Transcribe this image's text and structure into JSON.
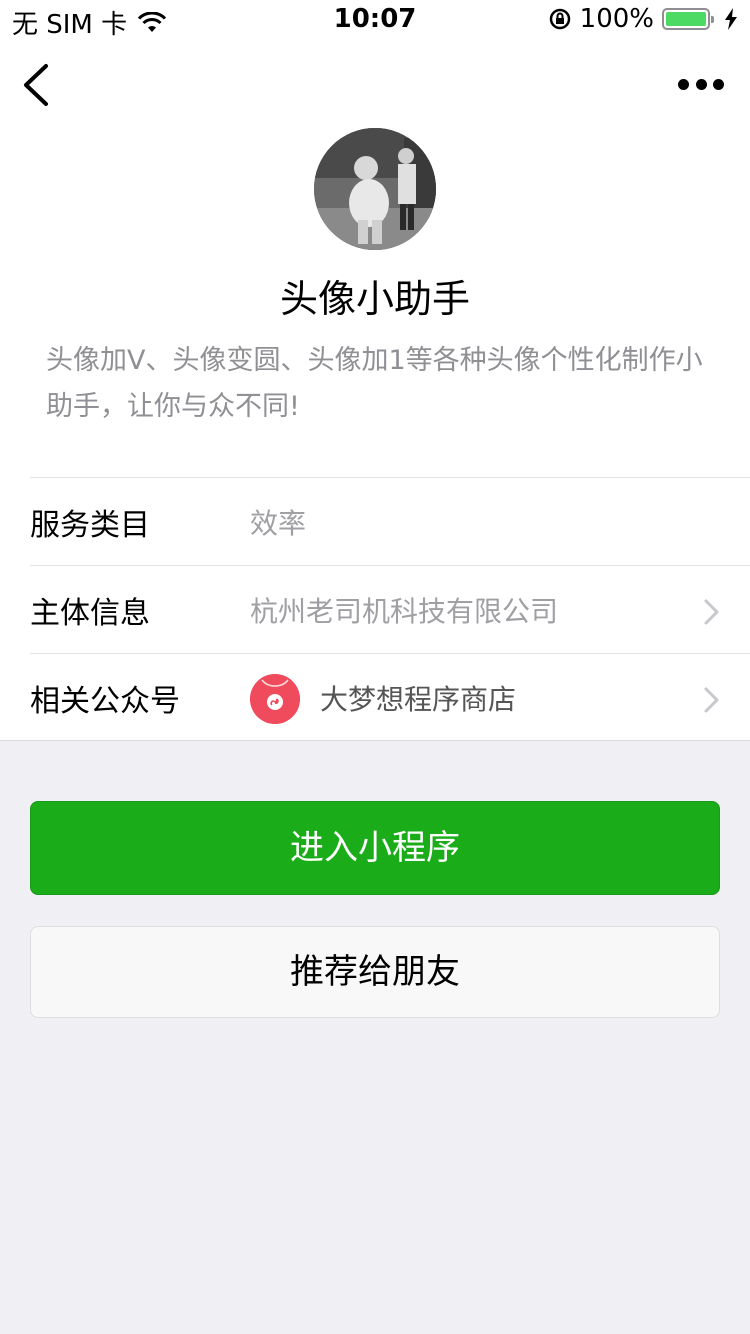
{
  "status_bar": {
    "carrier": "无 SIM 卡",
    "time": "10:07",
    "battery": "100%",
    "icons": [
      "wifi-icon",
      "rotation-lock-icon",
      "battery-icon",
      "charging-bolt-icon"
    ],
    "battery_color": "#4cd964"
  },
  "nav": {
    "back_icon": "chevron-left-icon",
    "more_icon": "more-dots-icon"
  },
  "profile": {
    "name": "头像小助手",
    "description": "头像加V、头像变圆、头像加1等各种头像个性化制作小助手，让你与众不同!"
  },
  "info": {
    "category_label": "服务类目",
    "category_value": "效率",
    "entity_label": "主体信息",
    "entity_value": "杭州老司机科技有限公司",
    "account_label": "相关公众号",
    "account_value": "大梦想程序商店",
    "account_logo_color": "#ef4b5c"
  },
  "actions": {
    "enter_label": "进入小程序",
    "share_label": "推荐给朋友",
    "primary_color": "#1aad19"
  }
}
